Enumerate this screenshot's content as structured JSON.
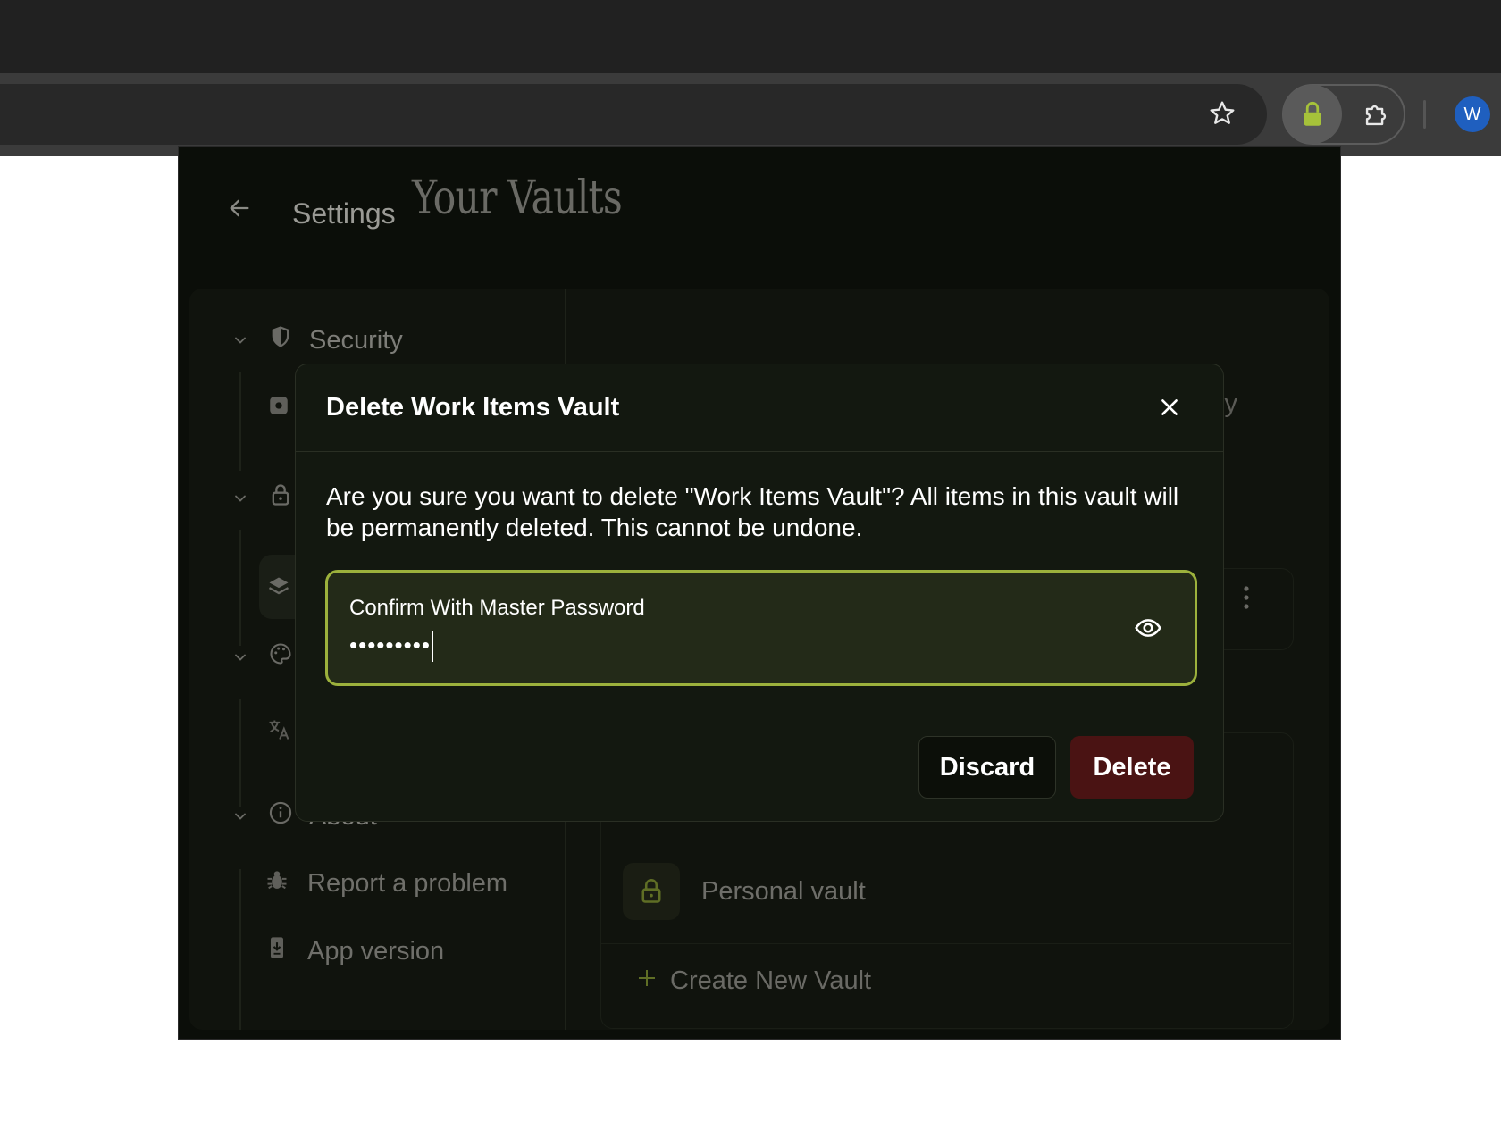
{
  "browser": {
    "profile_initial": "W",
    "icons": [
      "star-icon",
      "lock-extension-icon",
      "puzzle-icon"
    ]
  },
  "popup": {
    "header": {
      "title": "Settings"
    },
    "sidebar": {
      "sections": [
        {
          "label": "Security",
          "icon": "shield-icon"
        },
        {
          "label": "",
          "icon": "lock-icon"
        },
        {
          "label": "",
          "icon": "palette-icon"
        },
        {
          "label": "About",
          "icon": "info-icon"
        }
      ],
      "about_items": [
        {
          "label": "Report a problem",
          "icon": "bug-icon"
        },
        {
          "label": "App version",
          "icon": "phone-download-icon"
        }
      ]
    },
    "main": {
      "title": "Your Vaults",
      "faded_fragment": "ly",
      "vaults": [
        {
          "name": "Personal vault",
          "icon": "lock-icon"
        }
      ],
      "create_label": "Create New Vault"
    }
  },
  "modal": {
    "title": "Delete Work Items Vault",
    "message": "Are you sure you want to delete \"Work Items Vault\"? All items in this vault will be permanently deleted. This cannot be undone.",
    "password_label": "Confirm With Master Password",
    "password_mask": "•••••••••",
    "discard_label": "Discard",
    "delete_label": "Delete"
  },
  "colors": {
    "accent": "#9cb13c",
    "danger": "#4a1313",
    "popup_bg": "#0b0e09",
    "modal_bg": "#131810"
  }
}
